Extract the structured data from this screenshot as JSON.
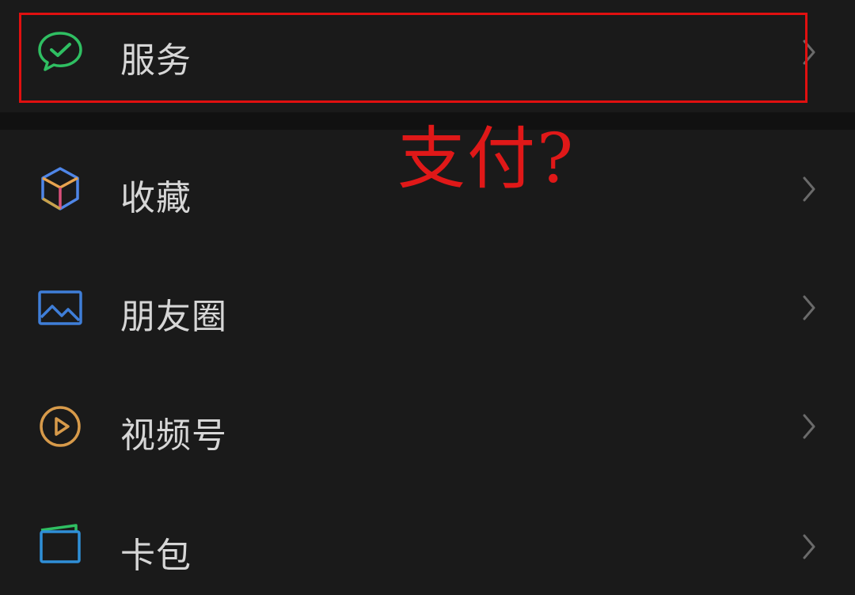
{
  "menu": {
    "items": [
      {
        "label": "服务",
        "icon": "wechat-pay-check-icon",
        "color": "#2fbf62"
      },
      {
        "label": "收藏",
        "icon": "favorites-cube-icon",
        "color": "#4f86e8"
      },
      {
        "label": "朋友圈",
        "icon": "moments-picture-icon",
        "color": "#3f7ed8"
      },
      {
        "label": "视频号",
        "icon": "channels-play-icon",
        "color": "#d79a4a"
      },
      {
        "label": "卡包",
        "icon": "card-wallet-icon",
        "color": "#2f8fd8"
      }
    ]
  },
  "annotation": {
    "text": "支付?",
    "color": "#e01010"
  }
}
